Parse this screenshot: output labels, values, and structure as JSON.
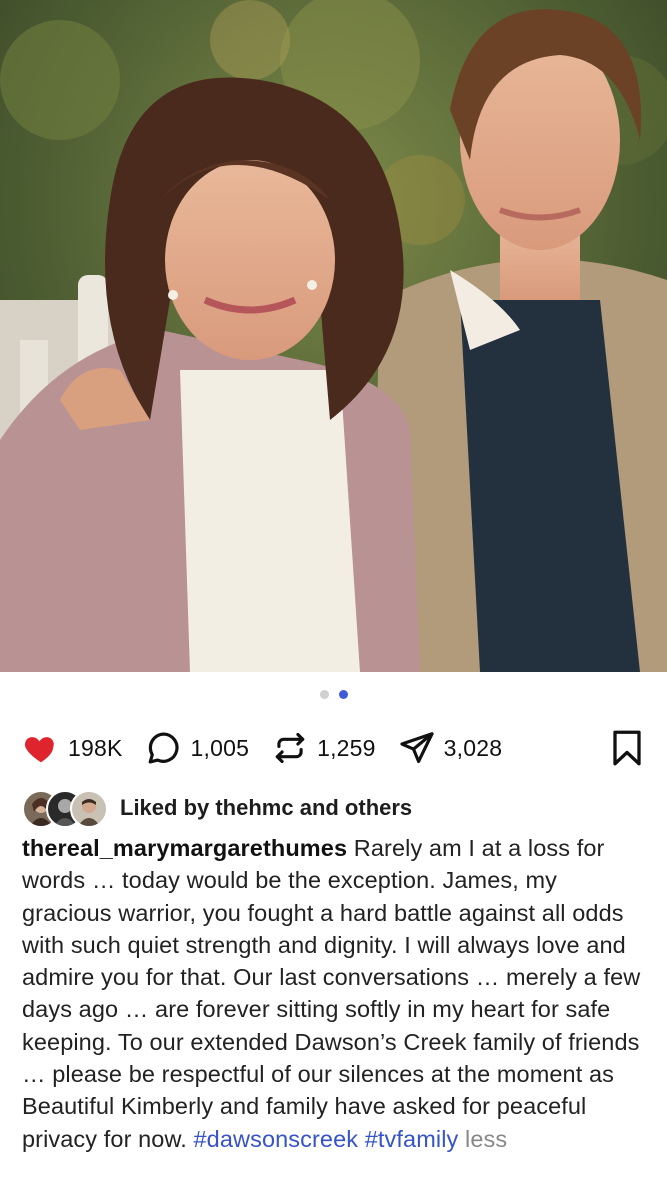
{
  "carousel": {
    "total": 2,
    "active_index": 1
  },
  "actions": {
    "likes": "198K",
    "comments": "1,005",
    "reposts": "1,259",
    "shares": "3,028",
    "like_color": "#e0242e"
  },
  "liked_by": {
    "text": "Liked by thehmc and others"
  },
  "caption": {
    "username": "thereal_marymargarethumes",
    "body": "Rarely am I at a loss for words … today would be the exception. James, my gracious warrior, you fought a hard battle against all odds with such quiet strength and dignity. I will always love and admire you for that.  Our last conversations … merely a few days ago … are forever sitting softly in my heart for safe keeping. To our extended Dawson’s Creek family of friends … please be respectful of our silences at the moment as Beautiful Kimberly and family have asked for peaceful privacy for now.",
    "hashtag1": "#dawsonscreek",
    "hashtag2": "#tvfamily",
    "less": "less"
  },
  "colors": {
    "hashtag": "#3653c8",
    "active_dot": "#3f5bd8"
  }
}
